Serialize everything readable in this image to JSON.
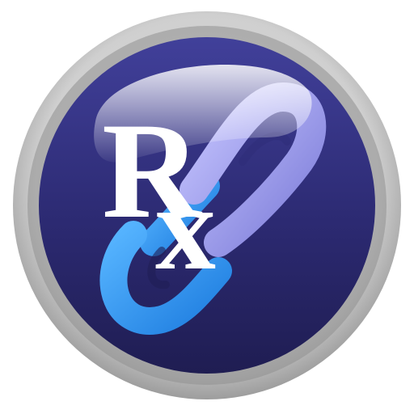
{
  "icon": {
    "name": "rx-chain-link-icon",
    "glyph_text": "Rx",
    "colors": {
      "background": "#ffffff",
      "ring_outer": "#c8c8c8",
      "ring_inner": "#9a9a9a",
      "disc_top": "#3e3d8c",
      "disc_bottom": "#201e55",
      "link_blue": "#2b8be8",
      "link_blue_light": "#56b4ff",
      "link_lavender": "#a9a8f0",
      "link_lavender_dark": "#7c7cd6",
      "rx_text": "#ffffff"
    }
  }
}
